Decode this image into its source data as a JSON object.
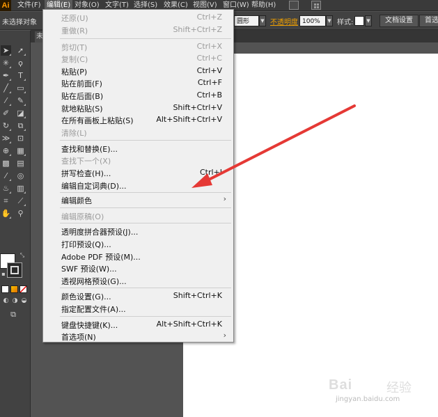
{
  "app": {
    "logo": "Ai"
  },
  "menubar": {
    "items": [
      "文件(F)",
      "编辑(E)",
      "对象(O)",
      "文字(T)",
      "选择(S)",
      "效果(C)",
      "视图(V)",
      "窗口(W)",
      "帮助(H)"
    ],
    "active": "编辑(E)"
  },
  "controlbar": {
    "selection_status": "未选择对象",
    "brush_value": "圆形",
    "opacity_label": "不透明度",
    "opacity_value": "100%",
    "style_label": "样式:",
    "doc_setup_button": "文档设置",
    "prefs_button": "首选"
  },
  "tabbar": {
    "tab_label": "未"
  },
  "edit_menu": {
    "items": [
      {
        "label": "还原(U)",
        "shortcut": "Ctrl+Z",
        "disabled": true
      },
      {
        "label": "重做(R)",
        "shortcut": "Shift+Ctrl+Z",
        "disabled": true
      },
      {
        "label": "剪切(T)",
        "shortcut": "Ctrl+X",
        "disabled": true
      },
      {
        "label": "复制(C)",
        "shortcut": "Ctrl+C",
        "disabled": true
      },
      {
        "label": "粘贴(P)",
        "shortcut": "Ctrl+V",
        "disabled": false
      },
      {
        "label": "贴在前面(F)",
        "shortcut": "Ctrl+F",
        "disabled": false
      },
      {
        "label": "贴在后面(B)",
        "shortcut": "Ctrl+B",
        "disabled": false
      },
      {
        "label": "就地粘贴(S)",
        "shortcut": "Shift+Ctrl+V",
        "disabled": false
      },
      {
        "label": "在所有画板上粘贴(S)",
        "shortcut": "Alt+Shift+Ctrl+V",
        "disabled": false
      },
      {
        "label": "清除(L)",
        "shortcut": "",
        "disabled": true
      },
      {
        "label": "查找和替换(E)...",
        "shortcut": "",
        "disabled": false
      },
      {
        "label": "查找下一个(X)",
        "shortcut": "",
        "disabled": true
      },
      {
        "label": "拼写检查(H)...",
        "shortcut": "Ctrl+I",
        "disabled": false
      },
      {
        "label": "编辑自定词典(D)...",
        "shortcut": "",
        "disabled": false
      },
      {
        "label": "编辑颜色",
        "shortcut": "",
        "disabled": false,
        "submenu": true
      },
      {
        "label": "编辑原稿(O)",
        "shortcut": "",
        "disabled": true
      },
      {
        "label": "透明度拼合器预设(J)...",
        "shortcut": "",
        "disabled": false
      },
      {
        "label": "打印预设(Q)...",
        "shortcut": "",
        "disabled": false
      },
      {
        "label": "Adobe PDF 预设(M)...",
        "shortcut": "",
        "disabled": false
      },
      {
        "label": "SWF 预设(W)...",
        "shortcut": "",
        "disabled": false
      },
      {
        "label": "透视网格预设(G)...",
        "shortcut": "",
        "disabled": false
      },
      {
        "label": "颜色设置(G)...",
        "shortcut": "Shift+Ctrl+K",
        "disabled": false
      },
      {
        "label": "指定配置文件(A)...",
        "shortcut": "",
        "disabled": false
      },
      {
        "label": "键盘快捷键(K)...",
        "shortcut": "Alt+Shift+Ctrl+K",
        "disabled": false
      },
      {
        "label": "首选项(N)",
        "shortcut": "",
        "disabled": false,
        "submenu": true
      }
    ],
    "submenu_glyph": "›"
  },
  "annotation": {
    "arrow_color": "#e53935"
  },
  "watermark": {
    "logo": "Bai",
    "logo_suffix": "经验",
    "url": "jingyan.baidu.com"
  },
  "colors": {
    "accent_orange": "#f0a000",
    "menu_bg": "#f0f0f0",
    "ui_dark": "#424242"
  }
}
